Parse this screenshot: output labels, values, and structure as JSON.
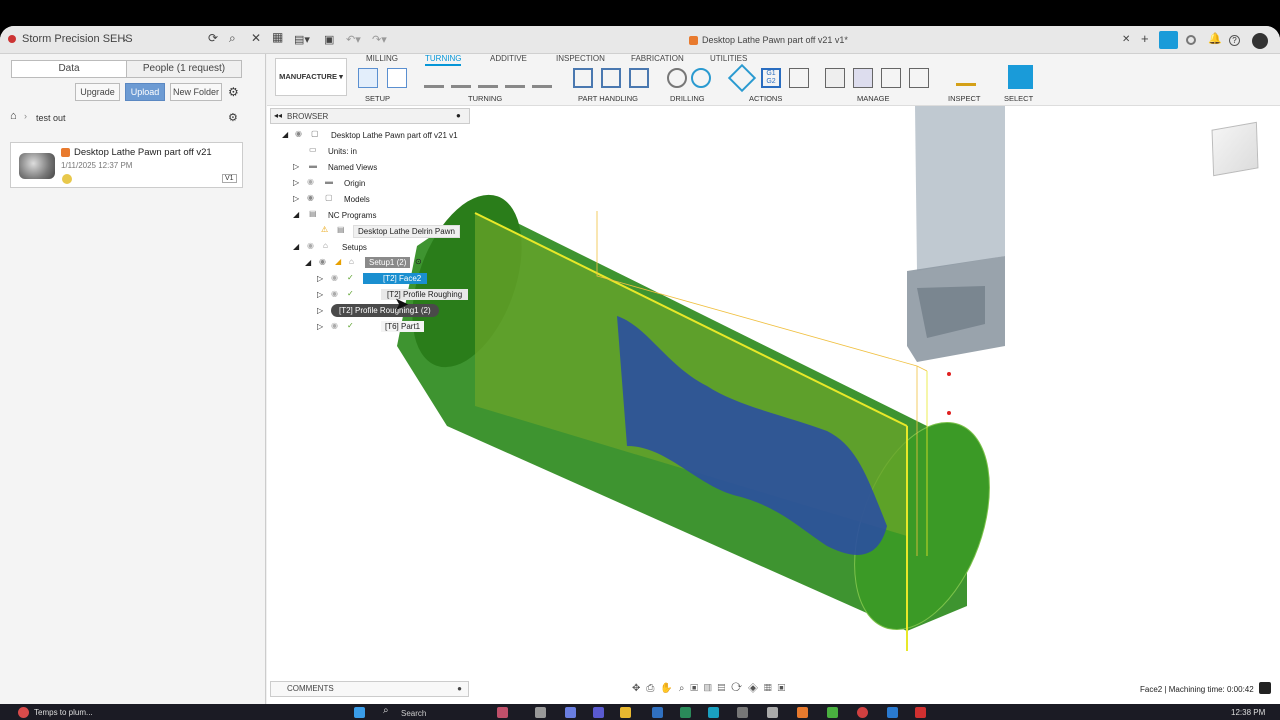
{
  "titlebar": {
    "team": "Storm Precision SEHS",
    "doc_title": "Desktop Lathe Pawn part off v21 v1*"
  },
  "left_panel": {
    "tab_data": "Data",
    "tab_people": "People (1 request)",
    "btn_upgrade": "Upgrade",
    "btn_upload": "Upload",
    "btn_new_folder": "New Folder",
    "breadcrumb": "test out",
    "file": {
      "name": "Desktop Lathe Pawn part off v21",
      "date": "1/11/2025 12:37 PM",
      "version": "V1"
    }
  },
  "toolbar": {
    "workspace": "MANUFACTURE",
    "tabs": [
      "MILLING",
      "TURNING",
      "ADDITIVE",
      "INSPECTION",
      "FABRICATION",
      "UTILITIES"
    ],
    "active_tab": "TURNING",
    "groups": [
      "SETUP",
      "TURNING",
      "PART HANDLING",
      "DRILLING",
      "ACTIONS",
      "MANAGE",
      "INSPECT",
      "SELECT"
    ]
  },
  "browser": {
    "header": "BROWSER",
    "root": "Desktop Lathe Pawn part off v21 v1",
    "units": "Units: in",
    "named_views": "Named Views",
    "origin": "Origin",
    "models": "Models",
    "nc_programs": "NC Programs",
    "nc_item": "Desktop Lathe Delrin Pawn",
    "setups": "Setups",
    "setup1": "Setup1 (2)",
    "op1": "[T2] Face2",
    "op2": "[T2] Profile Roughing",
    "op3_tooltip": "[T2] Profile Roughing1 (2)",
    "op4": "[T6] Part1"
  },
  "bottom": {
    "comments": "COMMENTS",
    "status": "Face2 | Machining time: 0:00:42"
  },
  "taskbar": {
    "weather": "Temps to plum...",
    "search": "Search",
    "time": "12:38 PM"
  },
  "colors": {
    "accent": "#0696d7",
    "stock_green": "#2e8b1e",
    "part_blue": "#2b4fa0"
  }
}
